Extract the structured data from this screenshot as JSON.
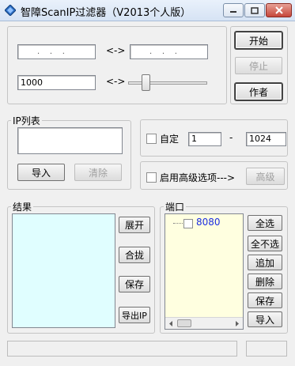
{
  "window": {
    "title": "智障ScanIP过滤器（V2013个人版）",
    "minimize_icon": "minimize-icon",
    "maximize_icon": "maximize-icon",
    "close_icon": "close-icon"
  },
  "range": {
    "arrow1": "<->",
    "arrow2": "<->",
    "ip_start_dots": ".    .    .",
    "ip_end_dots": ".    .    .",
    "threads_value": "1000"
  },
  "controls": {
    "start": "开始",
    "stop": "停止",
    "author": "作者"
  },
  "ip_list": {
    "legend": "IP列表",
    "import": "导入",
    "clear": "清除"
  },
  "custom_port": {
    "label": "自定",
    "from": "1",
    "dash": "-",
    "to": "1024"
  },
  "advanced": {
    "label": "启用高级选项--->",
    "button": "高级"
  },
  "results": {
    "legend": "结果",
    "expand": "展开",
    "merge": "合拢",
    "save": "保存",
    "export_ip": "导出IP"
  },
  "ports": {
    "legend": "端口",
    "items": [
      {
        "label": "8080"
      }
    ],
    "select_all": "全选",
    "select_none": "全不选",
    "add": "追加",
    "delete": "删除",
    "save": "保存",
    "import": "导入"
  },
  "colors": {
    "accent": "#1d2ee0",
    "results_bg": "#e0feff",
    "ports_bg": "#ffffe0"
  }
}
